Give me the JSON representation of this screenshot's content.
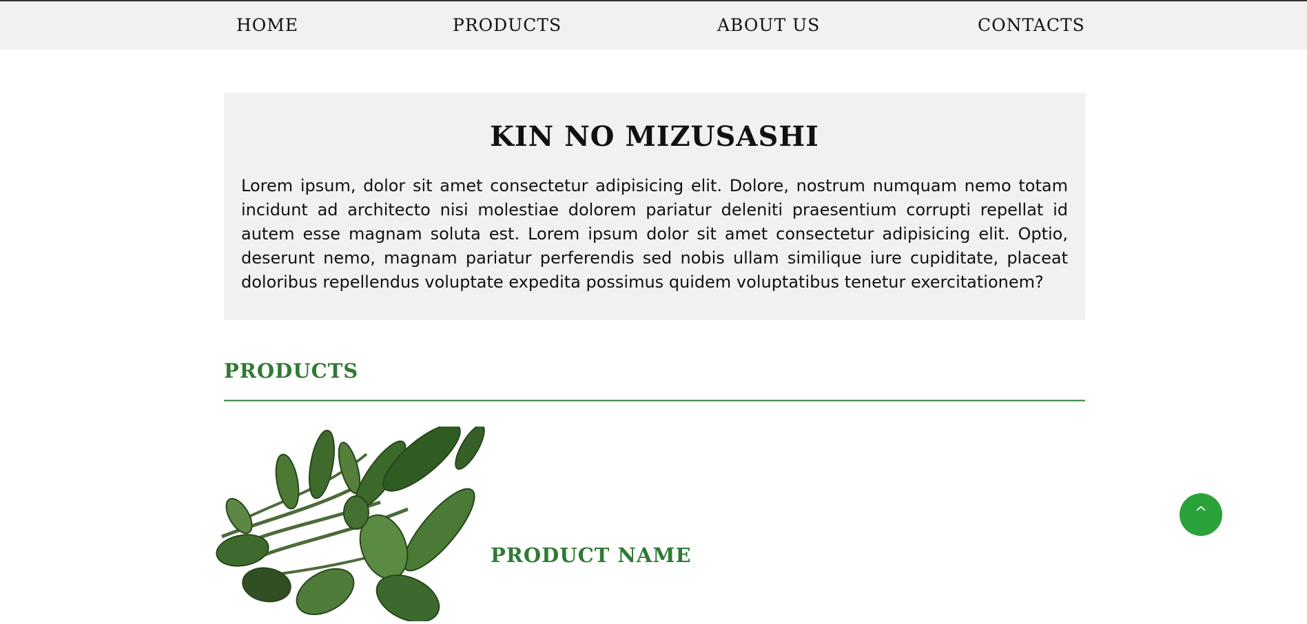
{
  "nav": {
    "items": [
      {
        "label": "HOME"
      },
      {
        "label": "PRODUCTS"
      },
      {
        "label": "ABOUT US"
      },
      {
        "label": "CONTACTS"
      }
    ]
  },
  "hero": {
    "title": "KIN NO MIZUSASHI",
    "text": "Lorem ipsum, dolor sit amet consectetur adipisicing elit. Dolore, nostrum numquam nemo totam incidunt ad architecto nisi molestiae dolorem pariatur deleniti praesentium corrupti repellat id autem esse magnam soluta est. Lorem ipsum dolor sit amet consectetur adipisicing elit. Optio, deserunt nemo, magnam pariatur perferendis sed nobis ullam similique iure cupiditate, placeat doloribus repellendus voluptate expedita possimus quidem voluptatibus tenetur exercitationem?"
  },
  "products": {
    "heading": "PRODUCTS",
    "items": [
      {
        "name": "PRODUCT NAME",
        "image_icon": "plant-image"
      }
    ]
  },
  "scroll_top": {
    "label": "^"
  },
  "colors": {
    "accent_green": "#2f7a34",
    "button_green": "#2aa13a",
    "panel_gray": "#f1f1f1"
  }
}
